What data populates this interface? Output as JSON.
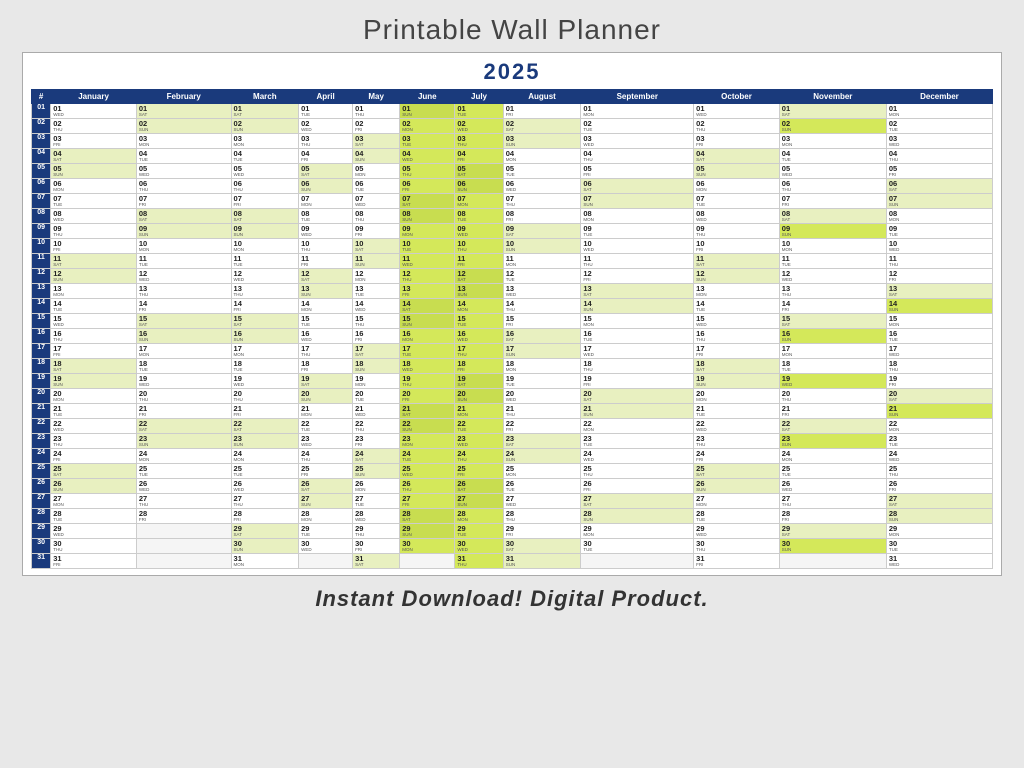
{
  "page": {
    "title": "Printable Wall Planner",
    "year": "2025",
    "footer": "Instant Download!  Digital Product."
  },
  "months": [
    {
      "name": "January",
      "abbr": "Jan"
    },
    {
      "name": "February",
      "abbr": "Feb"
    },
    {
      "name": "March",
      "abbr": "Mar"
    },
    {
      "name": "April",
      "abbr": "Apr"
    },
    {
      "name": "May",
      "abbr": "May"
    },
    {
      "name": "June",
      "abbr": "Jun"
    },
    {
      "name": "July",
      "abbr": "Jul"
    },
    {
      "name": "August",
      "abbr": "Aug"
    },
    {
      "name": "September",
      "abbr": "Sep"
    },
    {
      "name": "October",
      "abbr": "Oct"
    },
    {
      "name": "November",
      "abbr": "Nov"
    },
    {
      "name": "December",
      "abbr": "Dec"
    }
  ],
  "days_2025": {
    "Jan": [
      "WED",
      "THU",
      "FRI",
      "SAT",
      "SUN",
      "MON",
      "TUE",
      "WED",
      "THU",
      "FRI",
      "SAT",
      "SUN",
      "MON",
      "TUE",
      "WED",
      "THU",
      "FRI",
      "SAT",
      "SUN",
      "MON",
      "TUE",
      "WED",
      "THU",
      "FRI",
      "SAT",
      "SUN",
      "MON",
      "TUE",
      "WED",
      "THU",
      "FRI"
    ],
    "Feb": [
      "SAT",
      "SUN",
      "MON",
      "TUE",
      "WED",
      "THU",
      "FRI",
      "SAT",
      "SUN",
      "MON",
      "TUE",
      "WED",
      "THU",
      "FRI",
      "SAT",
      "SUN",
      "MON",
      "TUE",
      "WED",
      "THU",
      "FRI",
      "SAT",
      "SUN",
      "MON",
      "TUE",
      "WED",
      "THU",
      "FRI",
      "",
      "",
      ""
    ],
    "Mar": [
      "SAT",
      "SUN",
      "MON",
      "TUE",
      "WED",
      "THU",
      "FRI",
      "SAT",
      "SUN",
      "MON",
      "TUE",
      "WED",
      "THU",
      "FRI",
      "SAT",
      "SUN",
      "MON",
      "TUE",
      "WED",
      "THU",
      "FRI",
      "SAT",
      "SUN",
      "MON",
      "TUE",
      "WED",
      "THU",
      "FRI",
      "SAT",
      "SUN",
      "MON"
    ],
    "Apr": [
      "TUE",
      "WED",
      "THU",
      "FRI",
      "SAT",
      "SUN",
      "MON",
      "TUE",
      "WED",
      "THU",
      "FRI",
      "SAT",
      "SUN",
      "MON",
      "TUE",
      "WED",
      "THU",
      "FRI",
      "SAT",
      "SUN",
      "MON",
      "TUE",
      "WED",
      "THU",
      "FRI",
      "SAT",
      "SUN",
      "MON",
      "TUE",
      "WED",
      ""
    ],
    "May": [
      "THU",
      "FRI",
      "SAT",
      "SUN",
      "MON",
      "TUE",
      "WED",
      "THU",
      "FRI",
      "SAT",
      "SUN",
      "MON",
      "TUE",
      "WED",
      "THU",
      "FRI",
      "SAT",
      "SUN",
      "MON",
      "TUE",
      "WED",
      "THU",
      "FRI",
      "SAT",
      "SUN",
      "MON",
      "TUE",
      "WED",
      "THU",
      "FRI",
      "SAT"
    ],
    "Jun": [
      "SUN",
      "MON",
      "TUE",
      "WED",
      "THU",
      "FRI",
      "SAT",
      "SUN",
      "MON",
      "TUE",
      "WED",
      "THU",
      "FRI",
      "SAT",
      "SUN",
      "MON",
      "TUE",
      "WED",
      "THU",
      "FRI",
      "SAT",
      "SUN",
      "MON",
      "TUE",
      "WED",
      "THU",
      "FRI",
      "SAT",
      "SUN",
      "MON",
      ""
    ],
    "Jul": [
      "TUE",
      "WED",
      "THU",
      "FRI",
      "SAT",
      "SUN",
      "MON",
      "TUE",
      "WED",
      "THU",
      "FRI",
      "SAT",
      "SUN",
      "MON",
      "TUE",
      "WED",
      "THU",
      "FRI",
      "SAT",
      "SUN",
      "MON",
      "TUE",
      "WED",
      "THU",
      "FRI",
      "SAT",
      "SUN",
      "MON",
      "TUE",
      "WED",
      "THU"
    ],
    "Aug": [
      "FRI",
      "SAT",
      "SUN",
      "MON",
      "TUE",
      "WED",
      "THU",
      "FRI",
      "SAT",
      "SUN",
      "MON",
      "TUE",
      "WED",
      "THU",
      "FRI",
      "SAT",
      "SUN",
      "MON",
      "TUE",
      "WED",
      "THU",
      "FRI",
      "SAT",
      "SUN",
      "MON",
      "TUE",
      "WED",
      "THU",
      "FRI",
      "SAT",
      "SUN"
    ],
    "Sep": [
      "MON",
      "TUE",
      "WED",
      "THU",
      "FRI",
      "SAT",
      "SUN",
      "MON",
      "TUE",
      "WED",
      "THU",
      "FRI",
      "SAT",
      "SUN",
      "MON",
      "TUE",
      "WED",
      "THU",
      "FRI",
      "SAT",
      "SUN",
      "MON",
      "TUE",
      "WED",
      "THU",
      "FRI",
      "SAT",
      "SUN",
      "MON",
      "TUE",
      ""
    ],
    "Oct": [
      "WED",
      "THU",
      "FRI",
      "SAT",
      "SUN",
      "MON",
      "TUE",
      "WED",
      "THU",
      "FRI",
      "SAT",
      "SUN",
      "MON",
      "TUE",
      "WED",
      "THU",
      "FRI",
      "SAT",
      "SUN",
      "MON",
      "TUE",
      "WED",
      "THU",
      "FRI",
      "SAT",
      "SUN",
      "MON",
      "TUE",
      "WED",
      "THU",
      "FRI"
    ],
    "Nov": [
      "SAT",
      "SUN",
      "MON",
      "TUE",
      "WED",
      "THU",
      "FRI",
      "SAT",
      "SUN",
      "MON",
      "TUE",
      "WED",
      "THU",
      "FRI",
      "SAT",
      "SUN",
      "MON",
      "TUE",
      "WED",
      "THU",
      "FRI",
      "SAT",
      "SUN",
      "MON",
      "TUE",
      "WED",
      "THU",
      "FRI",
      "SAT",
      "SUN",
      ""
    ],
    "Dec": [
      "MON",
      "TUE",
      "WED",
      "THU",
      "FRI",
      "SAT",
      "SUN",
      "MON",
      "TUE",
      "WED",
      "THU",
      "FRI",
      "SAT",
      "SUN",
      "MON",
      "TUE",
      "WED",
      "THU",
      "FRI",
      "SAT",
      "SUN",
      "MON",
      "TUE",
      "WED",
      "THU",
      "FRI",
      "SAT",
      "SUN",
      "MON",
      "TUE",
      "WED"
    ]
  }
}
